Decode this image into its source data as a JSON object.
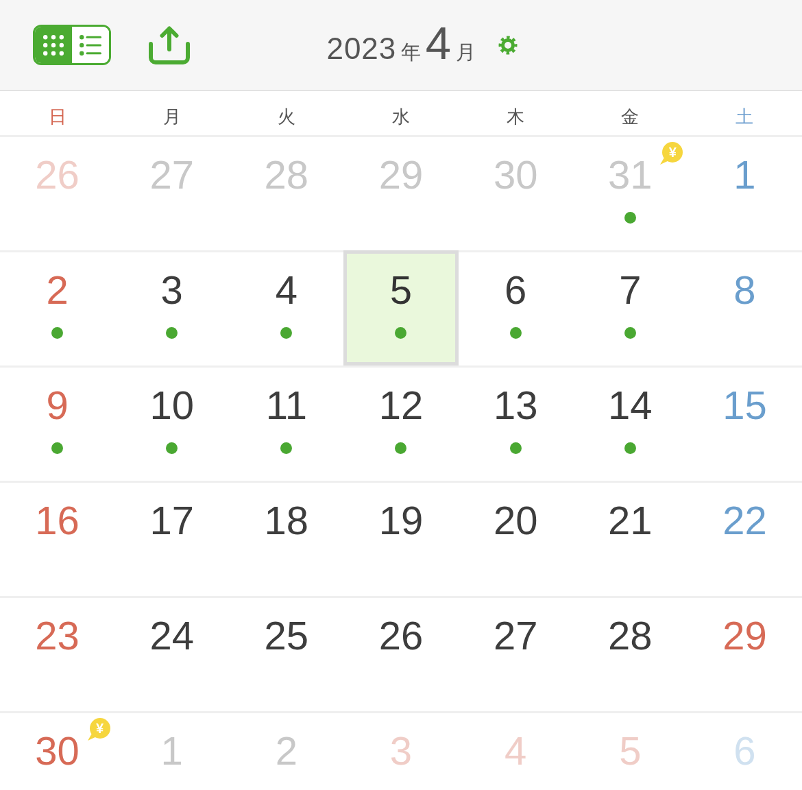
{
  "header": {
    "view_toggle": [
      {
        "selected": true
      },
      {
        "selected": false
      }
    ],
    "title": {
      "year": "2023",
      "year_unit": "年",
      "month": "4",
      "month_unit": "月"
    }
  },
  "weekdays": [
    {
      "label": "日",
      "kind": "sunday"
    },
    {
      "label": "月",
      "kind": "weekday"
    },
    {
      "label": "火",
      "kind": "weekday"
    },
    {
      "label": "水",
      "kind": "weekday"
    },
    {
      "label": "木",
      "kind": "weekday"
    },
    {
      "label": "金",
      "kind": "weekday"
    },
    {
      "label": "土",
      "kind": "saturday"
    }
  ],
  "weeks": [
    {
      "days": [
        {
          "date": "26",
          "in_month": false,
          "kind": "sunday",
          "selected": false,
          "event": false
        },
        {
          "date": "27",
          "in_month": false,
          "kind": "weekday",
          "selected": false,
          "event": false
        },
        {
          "date": "28",
          "in_month": false,
          "kind": "weekday",
          "selected": false,
          "event": false
        },
        {
          "date": "29",
          "in_month": false,
          "kind": "weekday",
          "selected": false,
          "event": false
        },
        {
          "date": "30",
          "in_month": false,
          "kind": "weekday",
          "selected": false,
          "event": false
        },
        {
          "date": "31",
          "in_month": false,
          "kind": "weekday",
          "selected": false,
          "event": true,
          "badge": "¥"
        },
        {
          "date": "1",
          "in_month": true,
          "kind": "saturday",
          "selected": false,
          "event": false
        }
      ]
    },
    {
      "days": [
        {
          "date": "2",
          "in_month": true,
          "kind": "sunday",
          "selected": false,
          "event": true
        },
        {
          "date": "3",
          "in_month": true,
          "kind": "weekday",
          "selected": false,
          "event": true
        },
        {
          "date": "4",
          "in_month": true,
          "kind": "weekday",
          "selected": false,
          "event": true
        },
        {
          "date": "5",
          "in_month": true,
          "kind": "weekday",
          "selected": true,
          "event": true
        },
        {
          "date": "6",
          "in_month": true,
          "kind": "weekday",
          "selected": false,
          "event": true
        },
        {
          "date": "7",
          "in_month": true,
          "kind": "weekday",
          "selected": false,
          "event": true
        },
        {
          "date": "8",
          "in_month": true,
          "kind": "saturday",
          "selected": false,
          "event": false
        }
      ]
    },
    {
      "days": [
        {
          "date": "9",
          "in_month": true,
          "kind": "sunday",
          "selected": false,
          "event": true
        },
        {
          "date": "10",
          "in_month": true,
          "kind": "weekday",
          "selected": false,
          "event": true
        },
        {
          "date": "11",
          "in_month": true,
          "kind": "weekday",
          "selected": false,
          "event": true
        },
        {
          "date": "12",
          "in_month": true,
          "kind": "weekday",
          "selected": false,
          "event": true
        },
        {
          "date": "13",
          "in_month": true,
          "kind": "weekday",
          "selected": false,
          "event": true
        },
        {
          "date": "14",
          "in_month": true,
          "kind": "weekday",
          "selected": false,
          "event": true
        },
        {
          "date": "15",
          "in_month": true,
          "kind": "saturday",
          "selected": false,
          "event": false
        }
      ]
    },
    {
      "days": [
        {
          "date": "16",
          "in_month": true,
          "kind": "sunday",
          "selected": false,
          "event": false
        },
        {
          "date": "17",
          "in_month": true,
          "kind": "weekday",
          "selected": false,
          "event": false
        },
        {
          "date": "18",
          "in_month": true,
          "kind": "weekday",
          "selected": false,
          "event": false
        },
        {
          "date": "19",
          "in_month": true,
          "kind": "weekday",
          "selected": false,
          "event": false
        },
        {
          "date": "20",
          "in_month": true,
          "kind": "weekday",
          "selected": false,
          "event": false
        },
        {
          "date": "21",
          "in_month": true,
          "kind": "weekday",
          "selected": false,
          "event": false
        },
        {
          "date": "22",
          "in_month": true,
          "kind": "saturday",
          "selected": false,
          "event": false
        }
      ]
    },
    {
      "days": [
        {
          "date": "23",
          "in_month": true,
          "kind": "sunday",
          "selected": false,
          "event": false
        },
        {
          "date": "24",
          "in_month": true,
          "kind": "weekday",
          "selected": false,
          "event": false
        },
        {
          "date": "25",
          "in_month": true,
          "kind": "weekday",
          "selected": false,
          "event": false
        },
        {
          "date": "26",
          "in_month": true,
          "kind": "weekday",
          "selected": false,
          "event": false
        },
        {
          "date": "27",
          "in_month": true,
          "kind": "weekday",
          "selected": false,
          "event": false
        },
        {
          "date": "28",
          "in_month": true,
          "kind": "weekday",
          "selected": false,
          "event": false
        },
        {
          "date": "29",
          "in_month": true,
          "kind": "holiday",
          "selected": false,
          "event": false
        }
      ]
    },
    {
      "days": [
        {
          "date": "30",
          "in_month": true,
          "kind": "sunday",
          "selected": false,
          "event": false,
          "badge": "¥"
        },
        {
          "date": "1",
          "in_month": false,
          "kind": "weekday",
          "selected": false,
          "event": false
        },
        {
          "date": "2",
          "in_month": false,
          "kind": "weekday",
          "selected": false,
          "event": false
        },
        {
          "date": "3",
          "in_month": false,
          "kind": "holiday",
          "selected": false,
          "event": false
        },
        {
          "date": "4",
          "in_month": false,
          "kind": "holiday",
          "selected": false,
          "event": false
        },
        {
          "date": "5",
          "in_month": false,
          "kind": "holiday",
          "selected": false,
          "event": false
        },
        {
          "date": "6",
          "in_month": false,
          "kind": "saturday",
          "selected": false,
          "event": false
        }
      ]
    }
  ]
}
